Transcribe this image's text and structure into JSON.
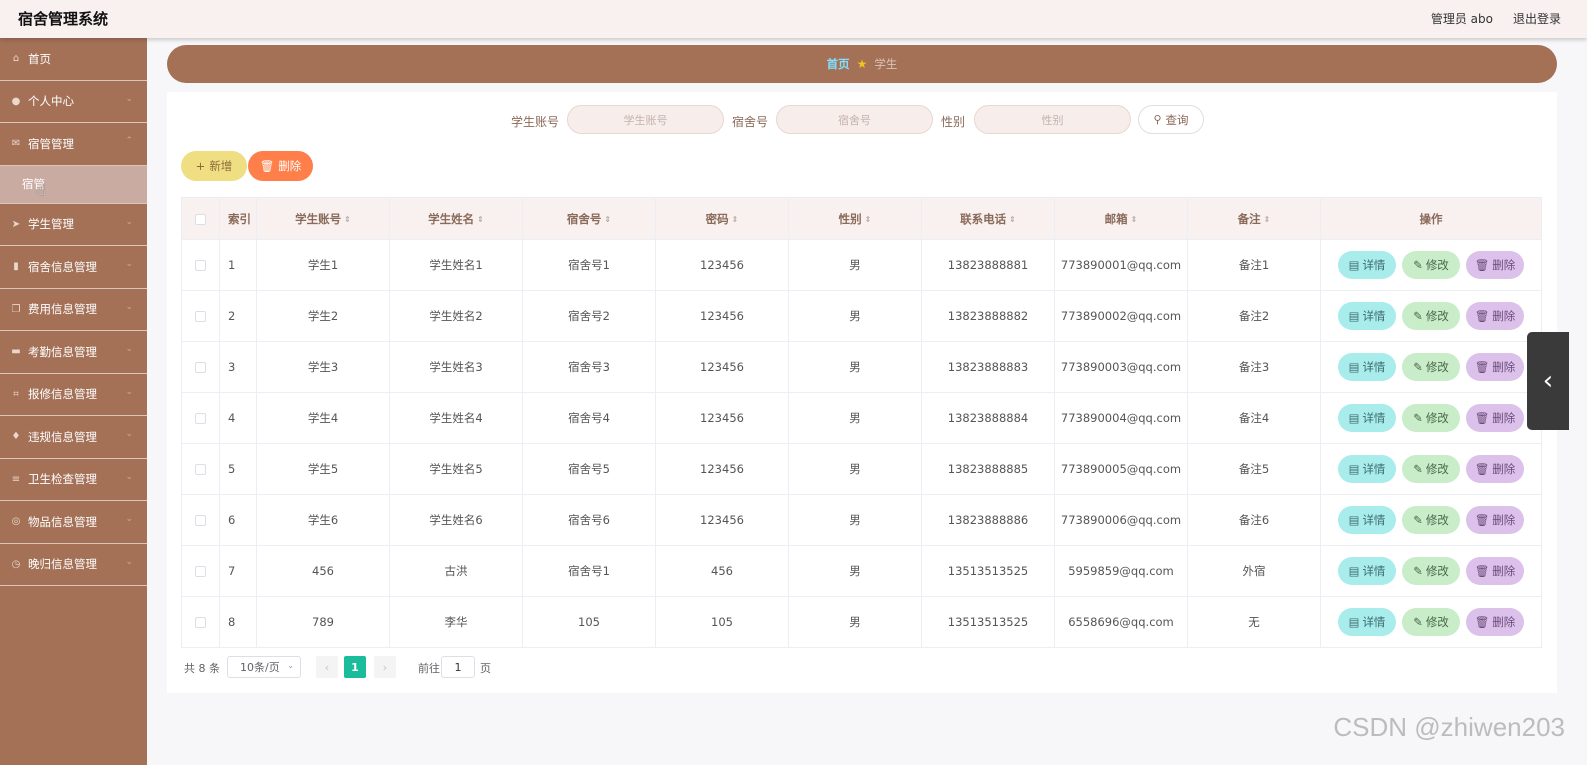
{
  "header": {
    "title": "宿舍管理系统",
    "user": "管理员 abo",
    "logout": "退出登录"
  },
  "sidebar": {
    "items": [
      {
        "label": "首页",
        "icon": "home-icon"
      },
      {
        "label": "个人中心",
        "icon": "user-icon"
      },
      {
        "label": "宿管管理",
        "icon": "mail-icon"
      },
      {
        "label": "宿管",
        "icon": ""
      },
      {
        "label": "学生管理",
        "icon": "send-icon"
      },
      {
        "label": "宿舍信息管理",
        "icon": "chart-icon"
      },
      {
        "label": "费用信息管理",
        "icon": "copy-icon"
      },
      {
        "label": "考勤信息管理",
        "icon": "monitor-icon"
      },
      {
        "label": "报修信息管理",
        "icon": "crop-icon"
      },
      {
        "label": "违规信息管理",
        "icon": "pin-icon"
      },
      {
        "label": "卫生检查管理",
        "icon": "list-icon"
      },
      {
        "label": "物品信息管理",
        "icon": "globe-icon"
      },
      {
        "label": "晚归信息管理",
        "icon": "clock-icon"
      }
    ]
  },
  "breadcrumb": {
    "home": "首页",
    "current": "学生"
  },
  "search": {
    "account_label": "学生账号",
    "account_placeholder": "学生账号",
    "dorm_label": "宿舍号",
    "dorm_placeholder": "宿舍号",
    "gender_label": "性别",
    "gender_placeholder": "性别",
    "query_button": "查询"
  },
  "actions": {
    "add": "新增",
    "delete": "删除"
  },
  "table": {
    "headers": [
      "索引",
      "学生账号",
      "学生姓名",
      "宿舍号",
      "密码",
      "性别",
      "联系电话",
      "邮箱",
      "备注",
      "操作"
    ],
    "rows": [
      [
        "1",
        "学生1",
        "学生姓名1",
        "宿舍号1",
        "123456",
        "男",
        "13823888881",
        "773890001@qq.com",
        "备注1"
      ],
      [
        "2",
        "学生2",
        "学生姓名2",
        "宿舍号2",
        "123456",
        "男",
        "13823888882",
        "773890002@qq.com",
        "备注2"
      ],
      [
        "3",
        "学生3",
        "学生姓名3",
        "宿舍号3",
        "123456",
        "男",
        "13823888883",
        "773890003@qq.com",
        "备注3"
      ],
      [
        "4",
        "学生4",
        "学生姓名4",
        "宿舍号4",
        "123456",
        "男",
        "13823888884",
        "773890004@qq.com",
        "备注4"
      ],
      [
        "5",
        "学生5",
        "学生姓名5",
        "宿舍号5",
        "123456",
        "男",
        "13823888885",
        "773890005@qq.com",
        "备注5"
      ],
      [
        "6",
        "学生6",
        "学生姓名6",
        "宿舍号6",
        "123456",
        "男",
        "13823888886",
        "773890006@qq.com",
        "备注6"
      ],
      [
        "7",
        "456",
        "古洪",
        "宿舍号1",
        "456",
        "男",
        "13513513525",
        "5959859@qq.com",
        "外宿"
      ],
      [
        "8",
        "789",
        "李华",
        "105",
        "105",
        "男",
        "13513513525",
        "6558696@qq.com",
        "无"
      ]
    ],
    "row_actions": {
      "detail": "详情",
      "edit": "修改",
      "delete": "删除"
    }
  },
  "pagination": {
    "total": "共 8 条",
    "page_size": "10条/页",
    "current_page": "1",
    "goto_prefix": "前往",
    "goto_value": "1",
    "goto_suffix": "页"
  },
  "watermark": "CSDN @zhiwen203",
  "colors": {
    "sidebar": "#a47157",
    "header": "#f8f1f0",
    "accent": "#1abc9c"
  }
}
